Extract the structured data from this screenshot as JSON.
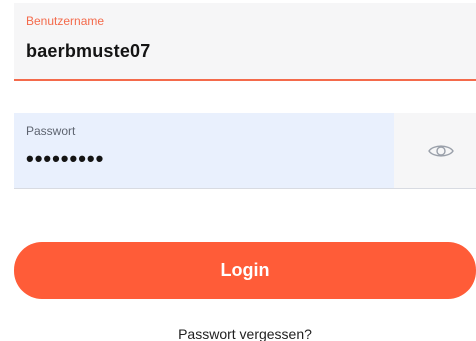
{
  "username": {
    "label": "Benutzername",
    "value": "baerbmuste07"
  },
  "password": {
    "label": "Passwort",
    "masked_value": "•••••••••",
    "toggle_icon": "eye-icon"
  },
  "login_button": {
    "label": "Login"
  },
  "forgot_password": {
    "label": "Passwort vergessen?"
  },
  "colors": {
    "accent": "#ff5c38",
    "active_field_border": "#f46a4b",
    "password_field_bg": "#e9f0fd"
  }
}
